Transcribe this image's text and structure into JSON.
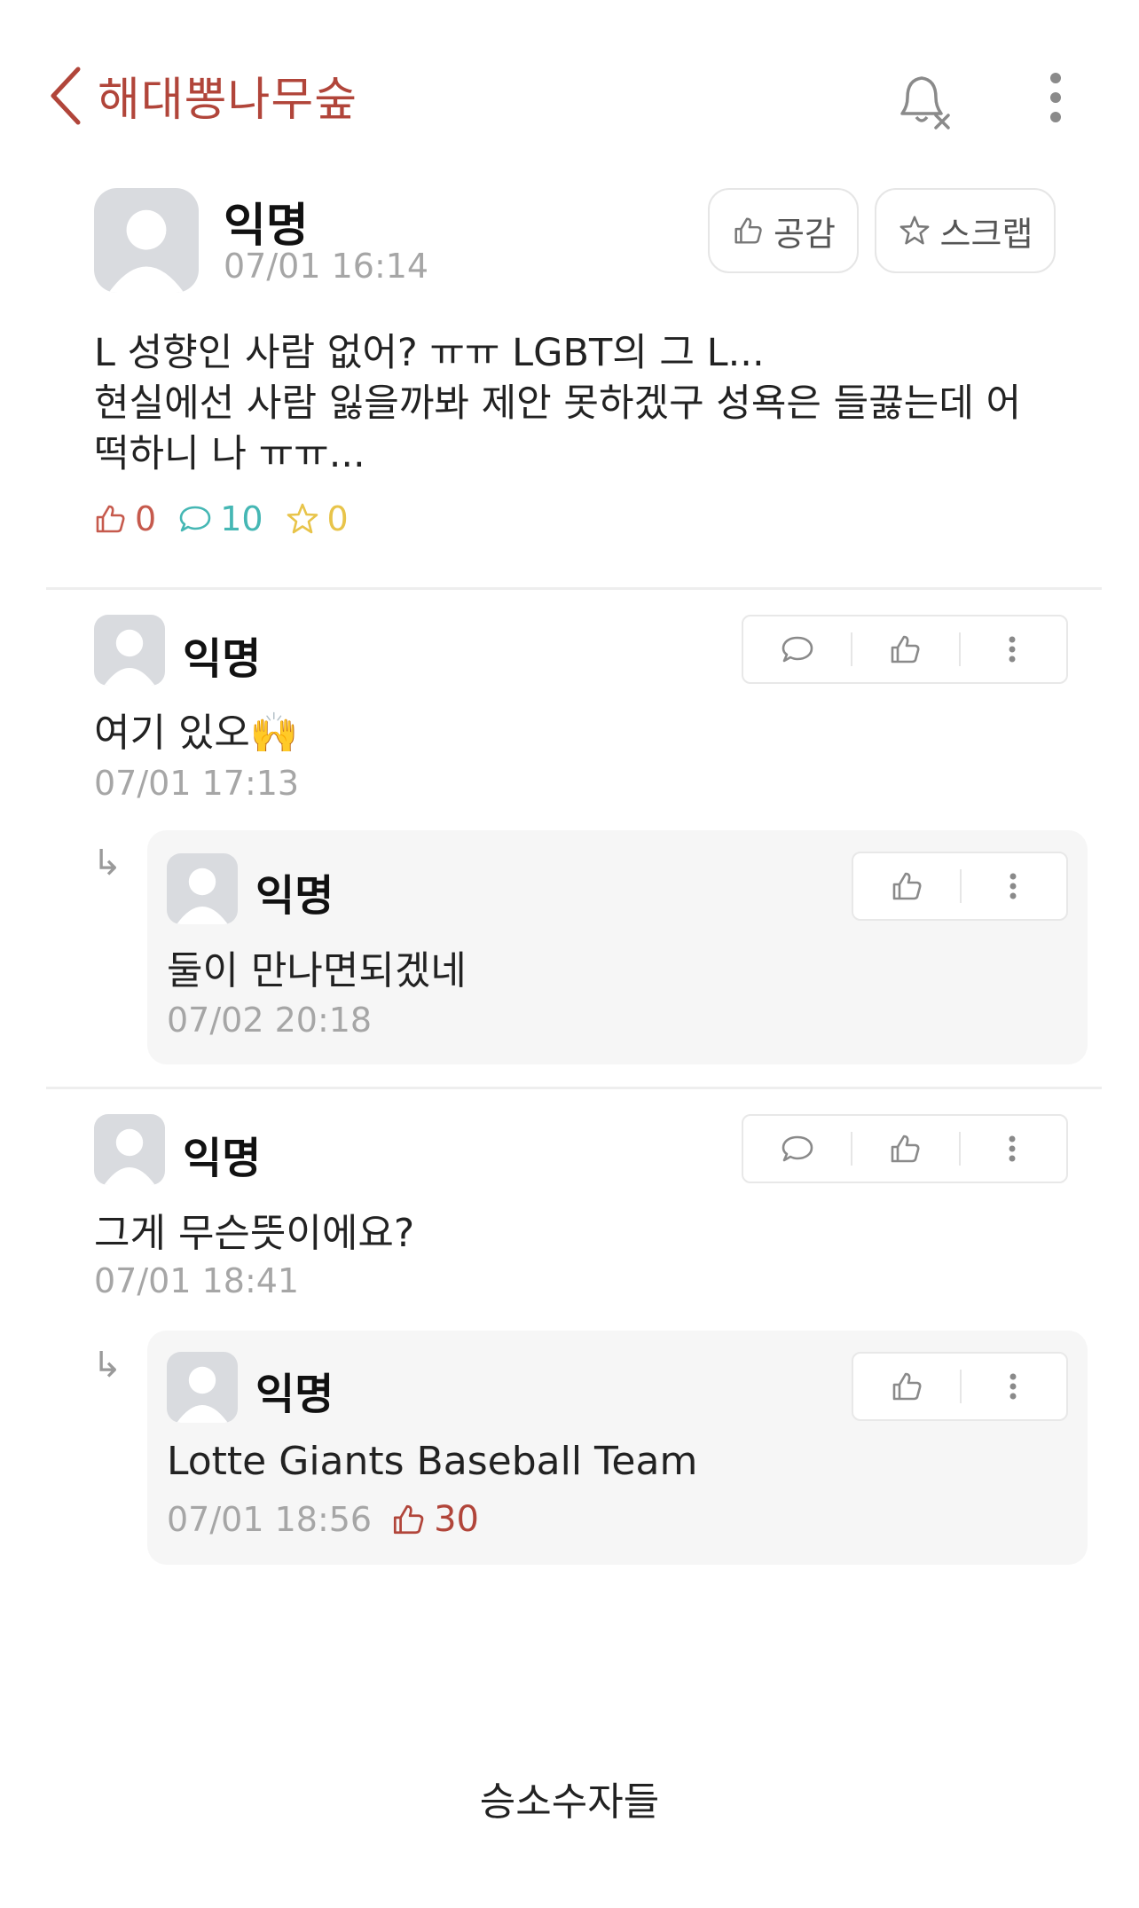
{
  "header": {
    "board_title": "해대뽕나무숲"
  },
  "post": {
    "author": "익명",
    "time": "07/01 16:14",
    "like_label": "공감",
    "scrap_label": "스크랩",
    "body": "L 성향인 사람 없어? ㅠㅠ LGBT의 그 L...\n현실에선 사람 잃을까봐 제안 못하겠구 성욕은 들끓는데 어\n떡하니 나 ㅠㅠ...",
    "stats": {
      "likes": "0",
      "comments": "10",
      "scraps": "0"
    }
  },
  "comments": [
    {
      "author": "익명",
      "text": "여기 있오🙌",
      "time": "07/01 17:13",
      "reply": {
        "author": "익명",
        "text": "둘이 만나면되겠네",
        "time": "07/02 20:18"
      }
    },
    {
      "author": "익명",
      "text": "그게 무슨뜻이에요?",
      "time": "07/01 18:41",
      "reply": {
        "author": "익명",
        "text": "Lotte Giants Baseball Team",
        "time": "07/01 18:56",
        "likes": "30"
      }
    }
  ],
  "caption": "승소수자들",
  "colors": {
    "accent": "#b1453a",
    "like_stat": "#c65a4d",
    "comment_stat": "#45b7b4",
    "scrap_stat": "#e8c44a",
    "avatar_bg": "#d9dbdf",
    "reply_bg": "#f6f6f6"
  },
  "icons": [
    "back-chevron-icon",
    "bell-off-icon",
    "more-vertical-icon",
    "thumbs-up-icon",
    "comment-bubble-icon",
    "star-icon",
    "reply-arrow-icon"
  ]
}
